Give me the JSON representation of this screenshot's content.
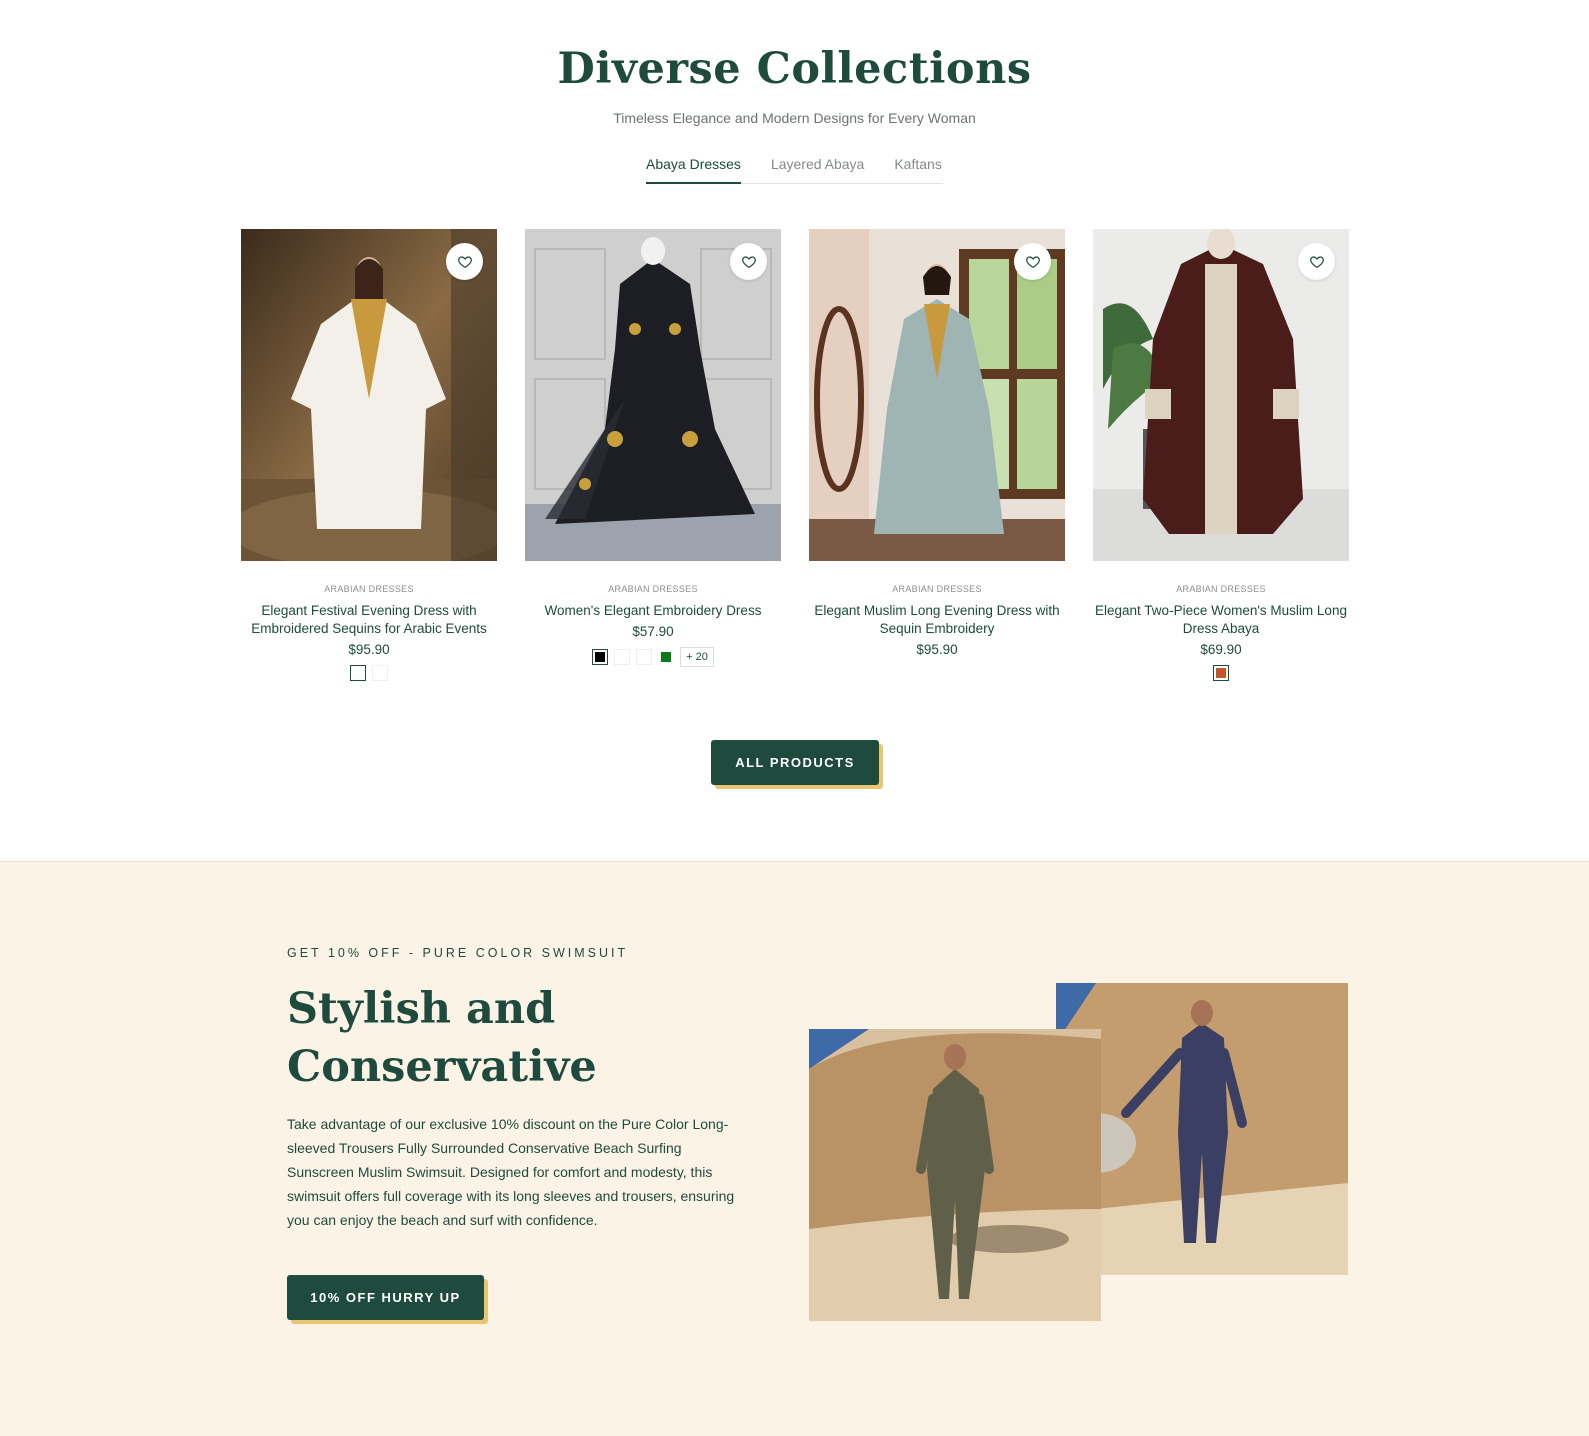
{
  "collections": {
    "title": "Diverse Collections",
    "subtitle": "Timeless Elegance and Modern Designs for Every Woman",
    "tabs": [
      {
        "label": "Abaya Dresses",
        "active": true
      },
      {
        "label": "Layered Abaya",
        "active": false
      },
      {
        "label": "Kaftans",
        "active": false
      }
    ],
    "products": [
      {
        "category": "ARABIAN DRESSES",
        "title": "Elegant Festival Evening Dress with Embroidered Sequins for Arabic Events",
        "price": "$95.90",
        "swatches": [
          "#ffffff",
          "#ffffff"
        ]
      },
      {
        "category": "ARABIAN DRESSES",
        "title": "Women's Elegant Embroidery Dress",
        "price": "$57.90",
        "swatches": [
          "#000000",
          "#ffffff",
          "#ffffff",
          "#0b7a16"
        ],
        "more": "+ 20"
      },
      {
        "category": "ARABIAN DRESSES",
        "title": "Elegant Muslim Long Evening Dress with Sequin Embroidery",
        "price": "$95.90",
        "swatches": []
      },
      {
        "category": "ARABIAN DRESSES",
        "title": "Elegant Two-Piece Women's Muslim Long Dress Abaya",
        "price": "$69.90",
        "swatches": [
          "#c2572b"
        ]
      }
    ],
    "all_button": "ALL PRODUCTS"
  },
  "promo": {
    "eyebrow": "GET 10% OFF - PURE COLOR SWIMSUIT",
    "title_line1": "Stylish and",
    "title_line2": "Conservative",
    "text": "Take advantage of our exclusive 10% discount on the Pure Color Long-sleeved Trousers Fully Surrounded Conservative Beach Surfing Sunscreen Muslim Swimsuit. Designed for comfort and modesty, this swimsuit offers full coverage with its long sleeves and trousers, ensuring you can enjoy the beach and surf with confidence.",
    "button": "10% OFF HURRY UP"
  },
  "colors": {
    "brand": "#1e4b3e",
    "accent": "#e8c56e",
    "promo_bg": "#fbf3e6"
  },
  "icons": {
    "wishlist": "heart-icon"
  }
}
